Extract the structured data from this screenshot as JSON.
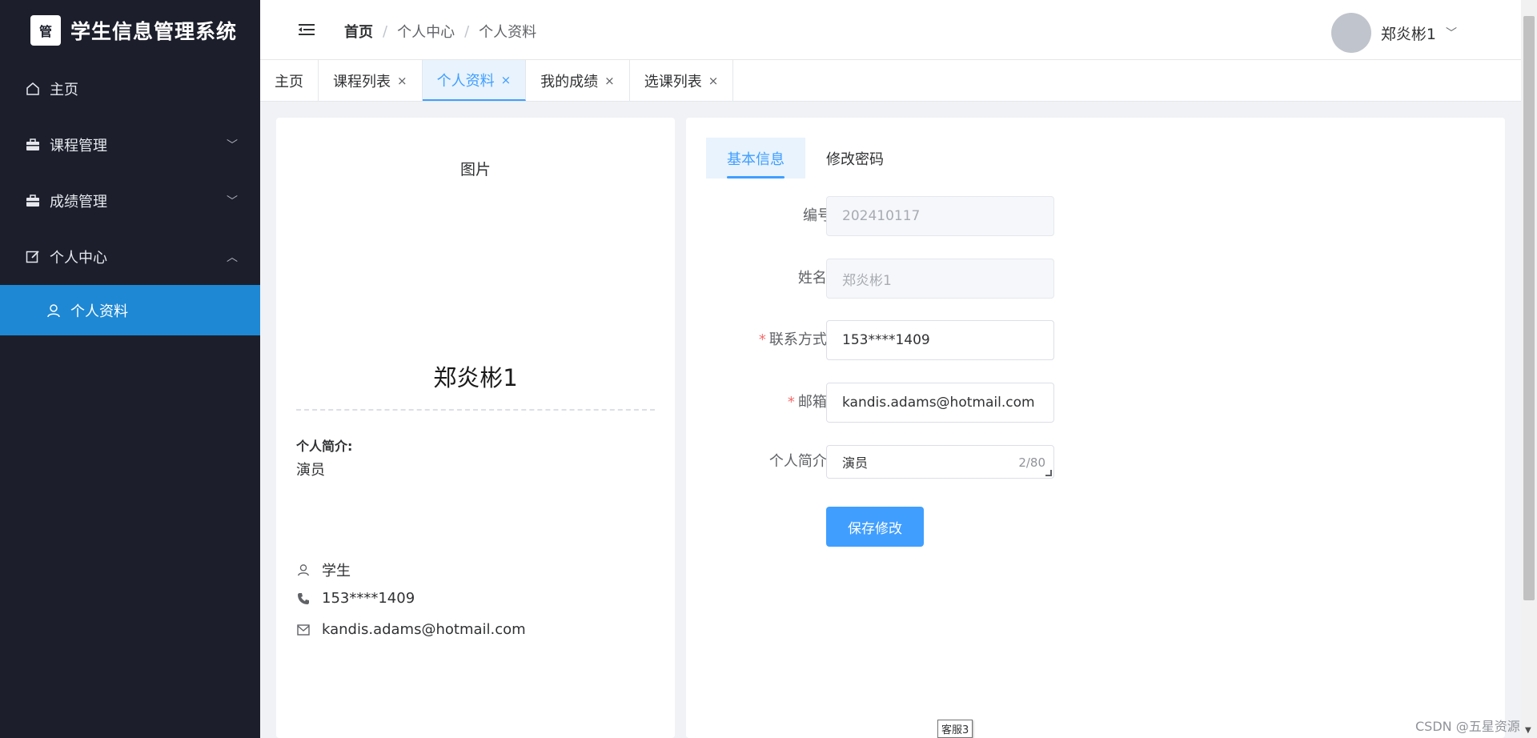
{
  "sidebar": {
    "brand_title": "学生信息管理系统",
    "brand_logo_text": "管",
    "menu": [
      {
        "label": "主页",
        "icon": "home-icon"
      },
      {
        "label": "课程管理",
        "icon": "briefcase-icon",
        "arrow": "﹀"
      },
      {
        "label": "成绩管理",
        "icon": "briefcase-icon",
        "arrow": "﹀"
      },
      {
        "label": "个人中心",
        "icon": "edit-icon",
        "arrow": "︿"
      }
    ],
    "submenu": [
      {
        "label": "个人资料",
        "icon": "user-icon",
        "active": true
      }
    ],
    "colors": {
      "background": "#1c1f2b",
      "active_item": "#1e88d4"
    }
  },
  "header": {
    "breadcrumb": [
      "首页",
      "个人中心",
      "个人资料"
    ],
    "breadcrumb_separator": "/",
    "username": "郑炎彬1",
    "caret": "﹀"
  },
  "tabs": [
    {
      "label": "主页",
      "closable": false,
      "active": false
    },
    {
      "label": "课程列表",
      "closable": true,
      "active": false
    },
    {
      "label": "个人资料",
      "closable": true,
      "active": true
    },
    {
      "label": "我的成绩",
      "closable": true,
      "active": false
    },
    {
      "label": "选课列表",
      "closable": true,
      "active": false
    }
  ],
  "tab_close_glyph": "×",
  "profile_card": {
    "image_label": "图片",
    "name": "郑炎彬1",
    "intro_label": "个人简介:",
    "intro_text": "演员",
    "role": "学生",
    "phone": "153****1409",
    "email": "kandis.adams@hotmail.com"
  },
  "form": {
    "tabs": [
      "基本信息",
      "修改密码"
    ],
    "fields": {
      "id_label": "编号",
      "id_value": "202410117",
      "name_label": "姓名:",
      "name_value": "郑炎彬1",
      "contact_label": "联系方式:",
      "contact_value": "153****1409",
      "email_label": "邮箱:",
      "email_value": "kandis.adams@hotmail.com",
      "intro_label": "个人简介:",
      "intro_value": "演员",
      "intro_count": "2/80"
    },
    "required_mark": "*",
    "save_label": "保存修改"
  },
  "overlay": {
    "kefu_label": "客服3",
    "watermark": "CSDN @五星资源"
  },
  "theme": {
    "primary": "#409eff",
    "danger": "#f56c6c"
  }
}
